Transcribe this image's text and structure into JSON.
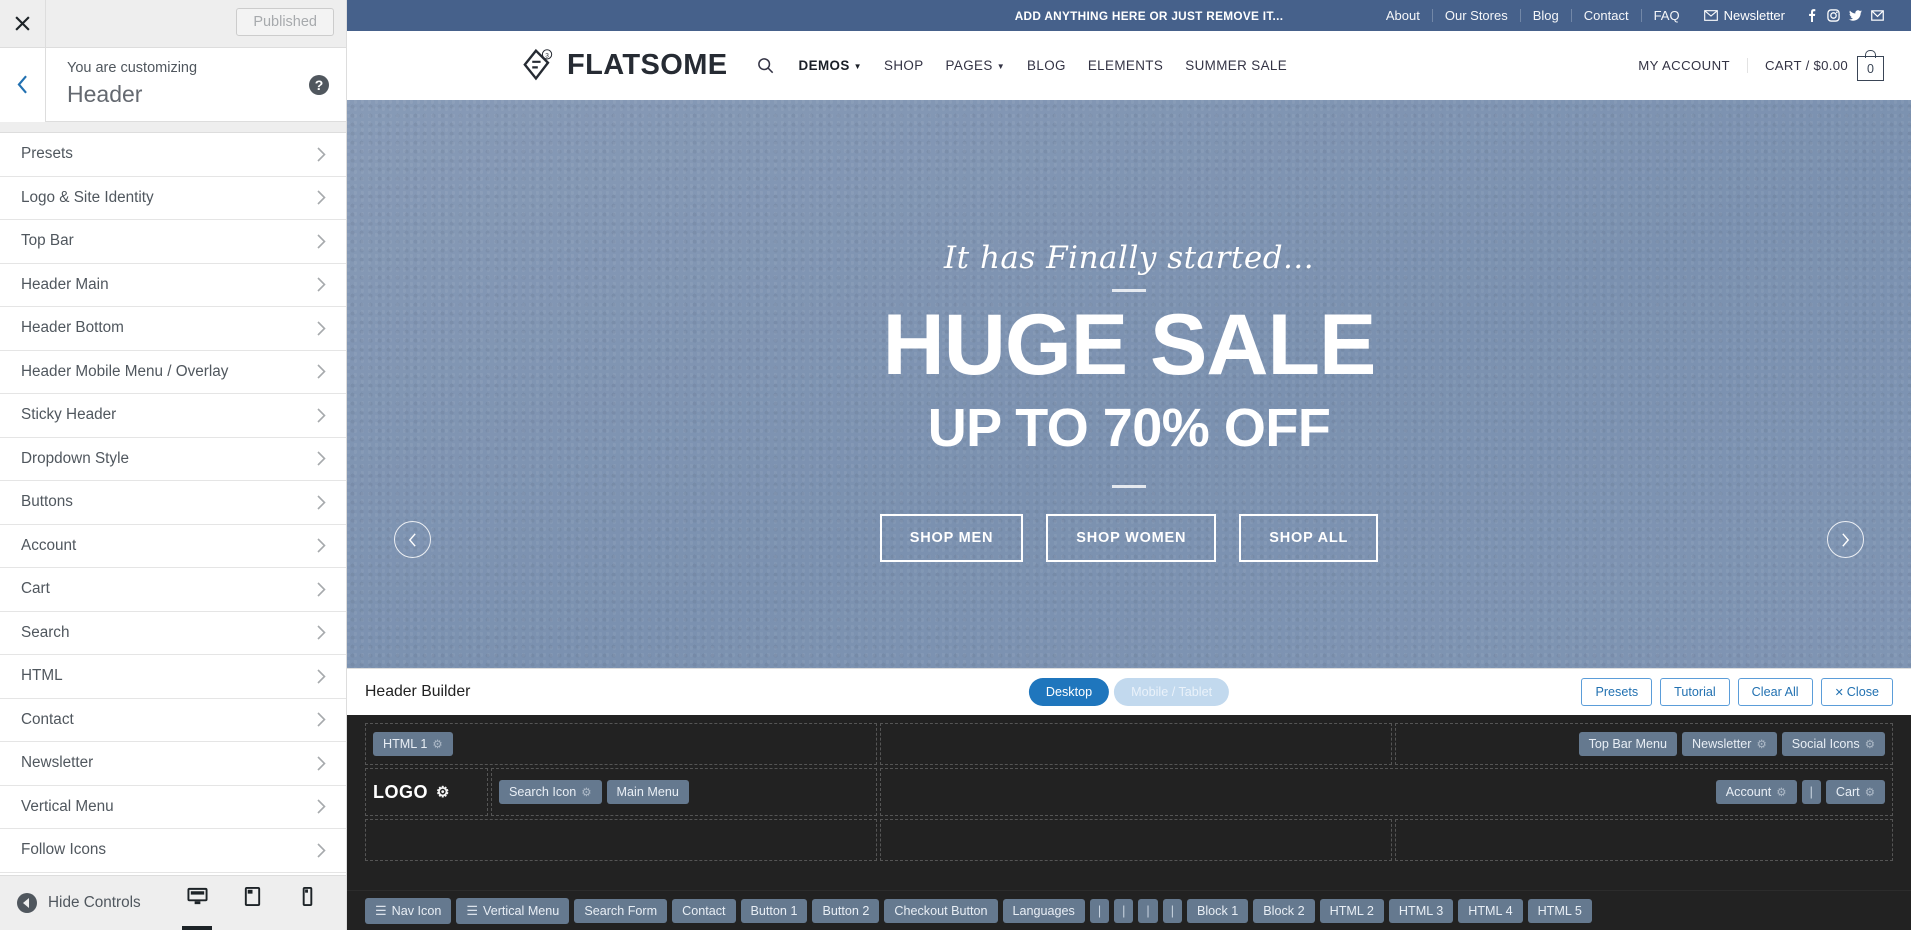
{
  "customizer": {
    "close_label": "✕",
    "published_label": "Published",
    "customizing_label": "You are customizing",
    "panel_title": "Header",
    "help_label": "?",
    "hide_controls_label": "Hide Controls",
    "devices": [
      {
        "name": "desktop",
        "active": true
      },
      {
        "name": "tablet",
        "active": false
      },
      {
        "name": "mobile",
        "active": false
      }
    ],
    "sections": [
      "Presets",
      "Logo & Site Identity",
      "Top Bar",
      "Header Main",
      "Header Bottom",
      "Header Mobile Menu / Overlay",
      "Sticky Header",
      "Dropdown Style",
      "Buttons",
      "Account",
      "Cart",
      "Search",
      "HTML",
      "Contact",
      "Newsletter",
      "Vertical Menu",
      "Follow Icons"
    ]
  },
  "site": {
    "topbar": {
      "promo": "ADD ANYTHING HERE OR JUST REMOVE IT...",
      "links": [
        "About",
        "Our Stores",
        "Blog",
        "Contact",
        "FAQ"
      ],
      "newsletter": "Newsletter",
      "socials": [
        "facebook-icon",
        "instagram-icon",
        "twitter-icon",
        "email-icon"
      ]
    },
    "header": {
      "logo_text": "FLATSOME",
      "logo_badge": "3",
      "nav": [
        {
          "label": "DEMOS",
          "caret": true,
          "active": true
        },
        {
          "label": "SHOP",
          "caret": false,
          "active": false
        },
        {
          "label": "PAGES",
          "caret": true,
          "active": false
        },
        {
          "label": "BLOG",
          "caret": false,
          "active": false
        },
        {
          "label": "ELEMENTS",
          "caret": false,
          "active": false
        },
        {
          "label": "SUMMER SALE",
          "caret": false,
          "active": false
        }
      ],
      "my_account": "MY ACCOUNT",
      "cart_label": "CART / $0.00",
      "cart_count": "0"
    },
    "hero": {
      "script": "It has Finally started...",
      "headline": "HUGE SALE",
      "subheadline": "UP TO 70% OFF",
      "buttons": [
        "SHOP MEN",
        "SHOP WOMEN",
        "SHOP ALL"
      ],
      "prev": "‹",
      "next": "›"
    }
  },
  "builder": {
    "title": "Header Builder",
    "toggles": [
      {
        "label": "Desktop",
        "active": true
      },
      {
        "label": "Mobile / Tablet",
        "active": false
      }
    ],
    "actions": [
      {
        "label": "Presets"
      },
      {
        "label": "Tutorial"
      },
      {
        "label": "Clear All"
      },
      {
        "label": "Close",
        "icon": "✕"
      }
    ],
    "rows": [
      {
        "name": "top-bar-row",
        "left": [
          {
            "label": "HTML 1",
            "gear": true
          }
        ],
        "middle": [],
        "right": [
          {
            "label": "Top Bar Menu",
            "gear": false
          },
          {
            "label": "Newsletter",
            "gear": true
          },
          {
            "label": "Social Icons",
            "gear": true
          }
        ]
      },
      {
        "name": "header-main-row",
        "logo": {
          "label": "LOGO",
          "gear": true
        },
        "left": [
          {
            "label": "Search Icon",
            "gear": true
          },
          {
            "label": "Main Menu",
            "gear": false
          }
        ],
        "middle": [],
        "right": [
          {
            "label": "Account",
            "gear": true
          },
          {
            "label": "|",
            "gear": false,
            "pipe": true
          },
          {
            "label": "Cart",
            "gear": true
          }
        ]
      },
      {
        "name": "header-bottom-row",
        "left": [],
        "middle": [],
        "right": []
      }
    ],
    "palette": [
      {
        "label": "Nav Icon",
        "menu": true
      },
      {
        "label": "Vertical Menu",
        "menu": true
      },
      {
        "label": "Search Form"
      },
      {
        "label": "Contact"
      },
      {
        "label": "Button 1"
      },
      {
        "label": "Button 2"
      },
      {
        "label": "Checkout Button"
      },
      {
        "label": "Languages"
      },
      {
        "label": "|",
        "pipe": true
      },
      {
        "label": "|",
        "pipe": true
      },
      {
        "label": "|",
        "pipe": true
      },
      {
        "label": "|",
        "pipe": true
      },
      {
        "label": "Block 1"
      },
      {
        "label": "Block 2"
      },
      {
        "label": "HTML 2"
      },
      {
        "label": "HTML 3"
      },
      {
        "label": "HTML 4"
      },
      {
        "label": "HTML 5"
      }
    ]
  },
  "colors": {
    "topbar_bg": "#46618b",
    "hero_bg": "#8096b4",
    "builder_bg": "#222222",
    "chip_bg": "#65798f",
    "accent_blue": "#1f76bd"
  }
}
